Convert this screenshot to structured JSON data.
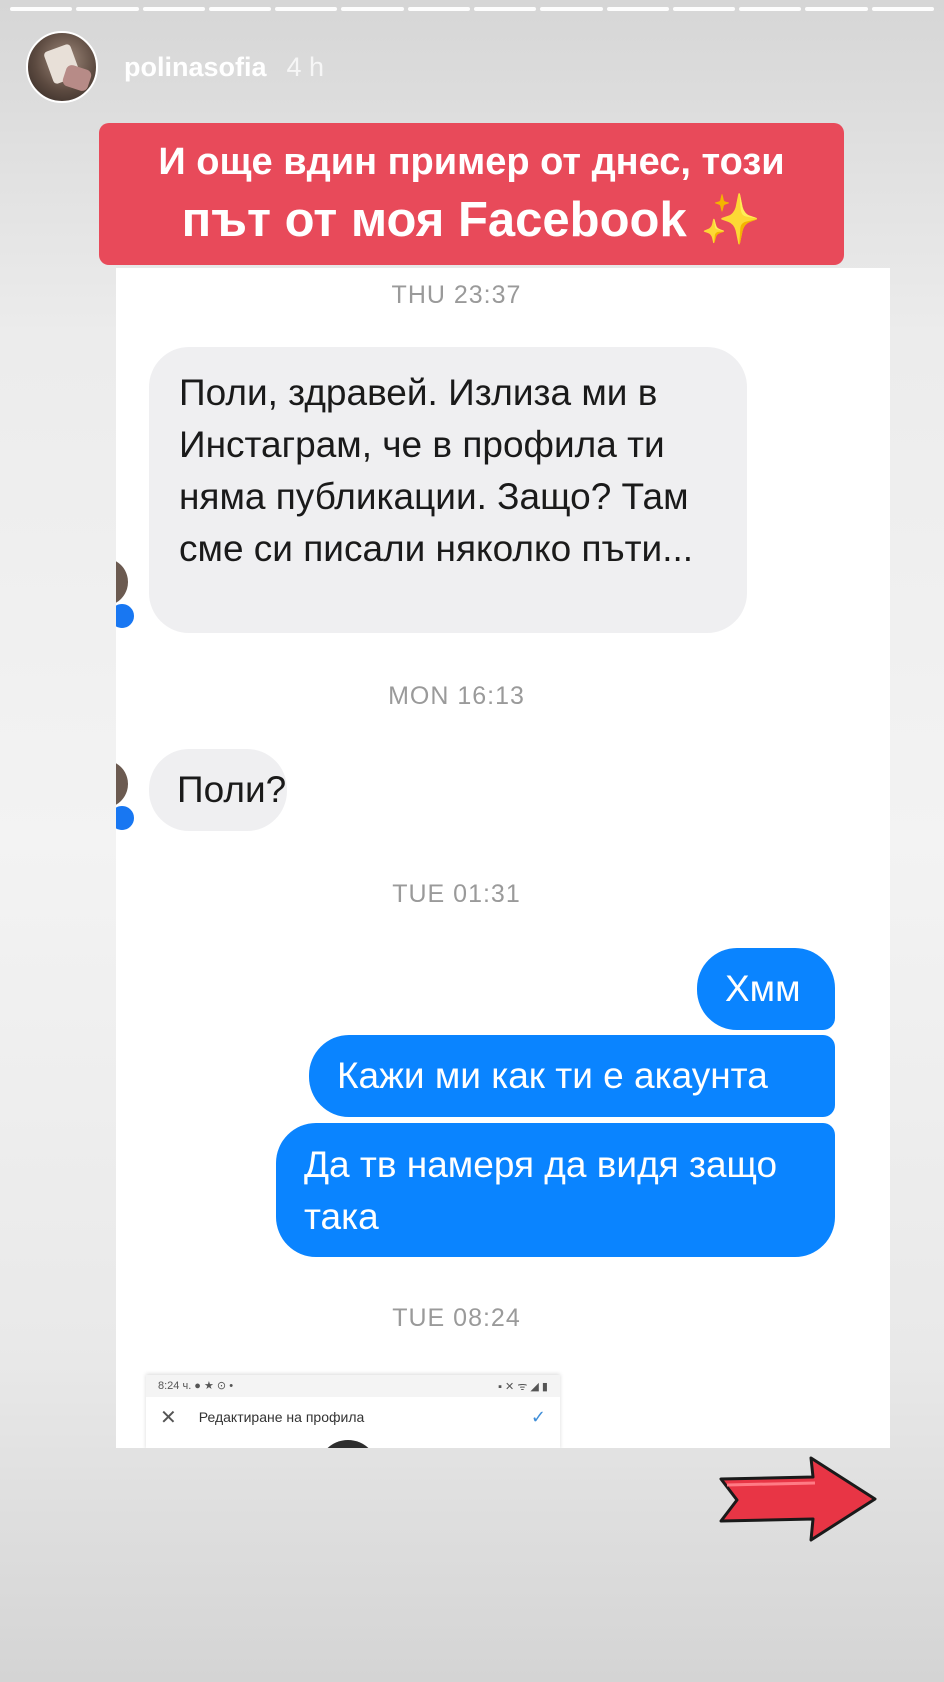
{
  "story": {
    "segments": 14,
    "username": "polinasofia",
    "time": "4 h"
  },
  "banner": {
    "line1": "И още вдин пример от днес, този",
    "line2": "път от моя Facebook",
    "emoji": "✨"
  },
  "chat": {
    "timestamps": [
      "THU 23:37",
      "MON 16:13",
      "TUE 01:31",
      "TUE 08:24"
    ],
    "incoming": [
      "Поли, здравей. Излиза ми в Инстаграм, че в профила ти няма публикации. Защо? Там сме си писали няколко пъти...",
      "Поли?"
    ],
    "outgoing": [
      "Хмм",
      "Кажи ми как ти е акаунта",
      "Да тв намеря да видя защо така"
    ],
    "embedded_screenshot": {
      "status_left": "8:24 ч. ● ★ ⊙ •",
      "status_right": "▪ ✕ ᯤ ◢ ▮",
      "title": "Редактиране на профила",
      "close_icon": "x-icon",
      "confirm_icon": "check-icon"
    }
  },
  "colors": {
    "banner": "#e84a5a",
    "outgoing_bubble": "#0a84ff",
    "incoming_bubble": "#efeff1",
    "arrow": "#e83545"
  },
  "icons": [
    "messenger-badge-icon",
    "next-arrow-icon"
  ]
}
